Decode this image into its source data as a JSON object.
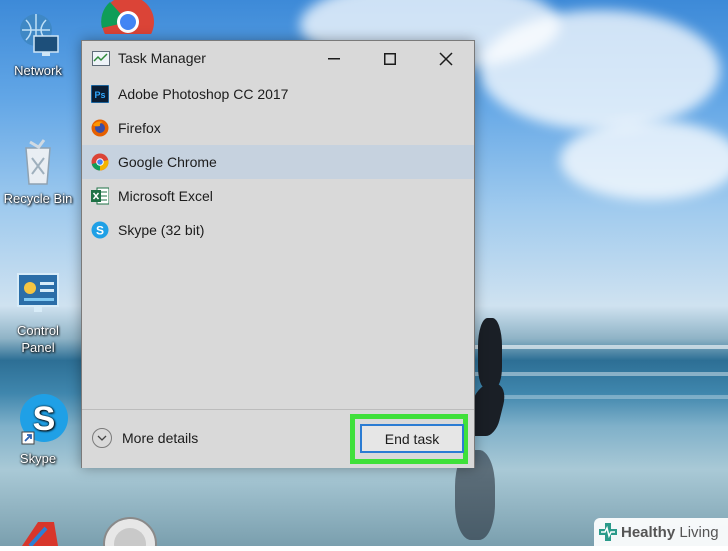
{
  "desktop": {
    "icons": [
      {
        "label": "Network",
        "icon": "network-icon"
      },
      {
        "label": "Recycle Bin",
        "icon": "recycle-bin-icon"
      },
      {
        "label": "Control Panel",
        "icon": "control-panel-icon"
      },
      {
        "label": "Skype",
        "icon": "skype-shortcut-icon"
      }
    ]
  },
  "task_manager": {
    "title": "Task Manager",
    "processes": [
      {
        "name": "Adobe Photoshop CC 2017",
        "icon": "photoshop-icon",
        "selected": false
      },
      {
        "name": "Firefox",
        "icon": "firefox-icon",
        "selected": false
      },
      {
        "name": "Google Chrome",
        "icon": "chrome-icon",
        "selected": true
      },
      {
        "name": "Microsoft Excel",
        "icon": "excel-icon",
        "selected": false
      },
      {
        "name": "Skype (32 bit)",
        "icon": "skype-icon",
        "selected": false
      }
    ],
    "more_details_label": "More details",
    "end_task_label": "End task"
  },
  "watermark": {
    "bold": "Healthy",
    "light": " Living"
  },
  "colors": {
    "selection": "#c6d2df",
    "highlight": "#3fe03a",
    "button_border": "#2b7cd3"
  }
}
